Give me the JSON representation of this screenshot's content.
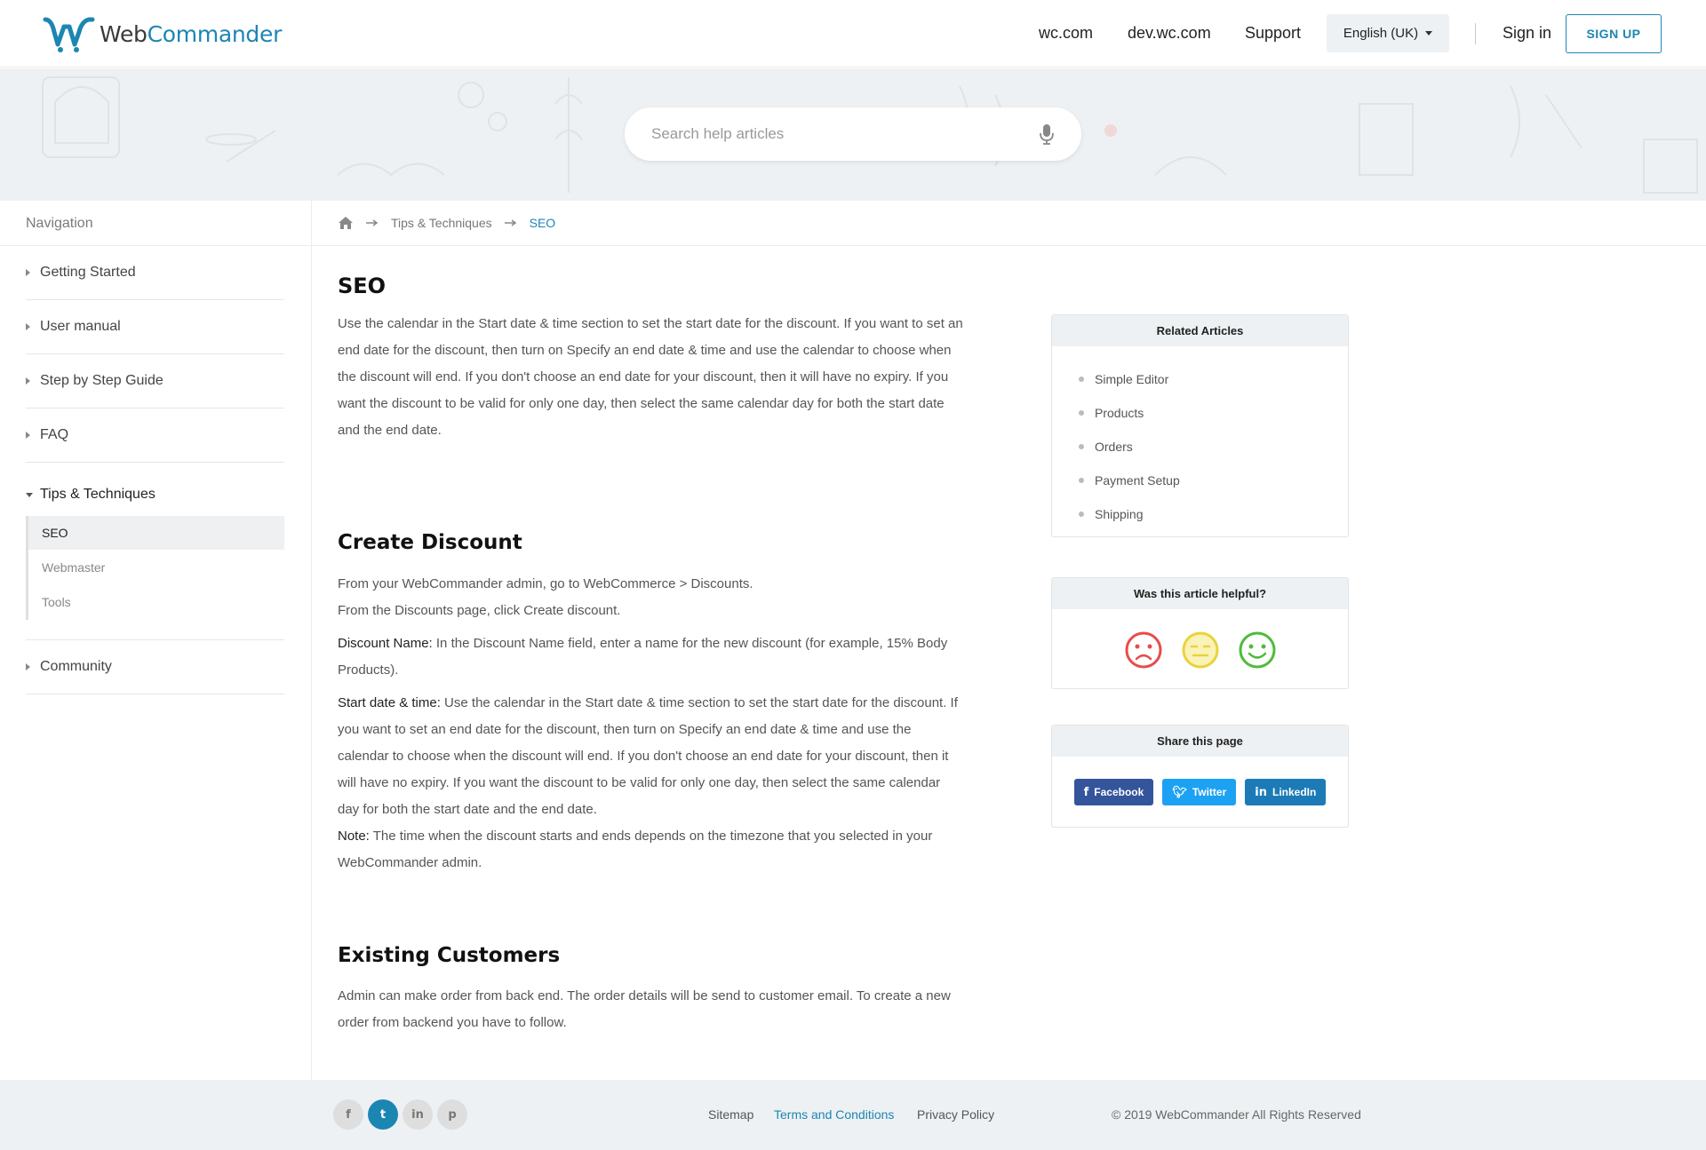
{
  "brand": {
    "name_part1": "Web",
    "name_part2": "Commander",
    "primary_color": "#1c86b3"
  },
  "header": {
    "links": [
      "wc.com",
      "dev.wc.com",
      "Support"
    ],
    "language": "English (UK)",
    "sign_in": "Sign in",
    "sign_up": "SIGN UP"
  },
  "search": {
    "placeholder": "Search help articles",
    "icon": "microphone-icon"
  },
  "sidebar": {
    "heading": "Navigation",
    "items": [
      "Getting Started",
      "User manual",
      "Step by Step Guide",
      "FAQ"
    ],
    "open_item": "Tips & Techniques",
    "sub_items": [
      "SEO",
      "Webmaster",
      "Tools"
    ],
    "active_sub": "SEO",
    "after_items": [
      "Community"
    ]
  },
  "breadcrumb": {
    "home_icon": "home-icon",
    "section": "Tips & Techniques",
    "current": "SEO"
  },
  "article": {
    "title": "SEO",
    "intro": "Use the calendar in the Start date & time section to set the start date for the discount. If you want to set an end date for the discount, then turn on Specify an end date & time and use the calendar to choose when the discount will end. If you don't choose an end date for your discount, then it will have no expiry. If you want the discount to be valid for only one day, then select the same calendar day for both the start date and the end date.",
    "section2_title": "Create Discount",
    "s2_line1": "From your WebCommander admin, go to WebCommerce > Discounts.",
    "s2_line2": "From the Discounts page, click Create discount.",
    "s2_name_label": "Discount Name:",
    "s2_name_text": " In the Discount Name field, enter a name for the new discount (for example, 15% Body Products).",
    "s2_date_label": "Start date & time:",
    "s2_date_text": " Use the calendar in the Start date & time section to set the start date for the discount. If you want to set an end date for the discount, then turn on Specify an end date & time and use the calendar to choose when the discount will end. If you don't choose an end date for your discount, then it will have no expiry. If you want the discount to be valid for only one day, then select the same calendar day for both the start date and the end date.",
    "s2_note_label": "Note:",
    "s2_note_text": " The time when the discount starts and ends depends on the timezone that you selected in your WebCommander admin.",
    "section3_title": "Existing Customers",
    "s3_text": "Admin can make order from back end. The order details will be send to customer email. To create a new order from backend you have to follow."
  },
  "related": {
    "title": "Related Articles",
    "items": [
      "Simple Editor",
      "Products",
      "Orders",
      "Payment Setup",
      "Shipping"
    ]
  },
  "helpful": {
    "title": "Was this article helpful?",
    "faces": [
      "sad-face-icon",
      "neutral-face-icon",
      "happy-face-icon"
    ],
    "colors": [
      "#e84c4c",
      "#e8d43a",
      "#4fbb3a"
    ]
  },
  "share": {
    "title": "Share this page",
    "buttons": [
      {
        "label": "Facebook",
        "icon": "f",
        "color": "#34549c"
      },
      {
        "label": "Twitter",
        "icon": "t",
        "color": "#1da1f2"
      },
      {
        "label": "LinkedIn",
        "icon": "in",
        "color": "#1c7bb6"
      }
    ]
  },
  "footer": {
    "social": [
      "facebook-icon",
      "twitter-icon",
      "linkedin-icon",
      "pinterest-icon"
    ],
    "social_glyphs": [
      "f",
      "t",
      "in",
      "p"
    ],
    "links": [
      "Sitemap",
      "Terms and Conditions",
      "Privacy Policy"
    ],
    "active_link": "Terms and Conditions",
    "copyright": "© 2019 WebCommander All Rights Reserved"
  }
}
